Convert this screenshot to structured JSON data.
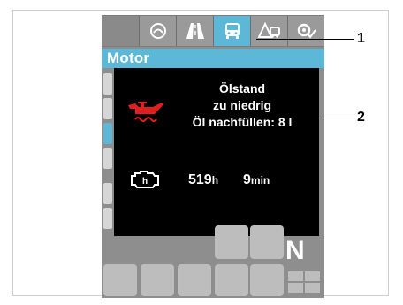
{
  "tabs": [
    {
      "icon": "blank-tab",
      "active": false
    },
    {
      "icon": "speedometer-icon",
      "active": false
    },
    {
      "icon": "road-icon",
      "active": false
    },
    {
      "icon": "bus-icon",
      "active": true
    },
    {
      "icon": "warning-bus-icon",
      "active": false
    },
    {
      "icon": "settings-check-icon",
      "active": false
    }
  ],
  "title": "Motor",
  "message": {
    "line1": "Ölstand",
    "line2": "zu niedrig",
    "line3": "Öl nachfüllen: 8 l"
  },
  "engine_hours": {
    "hours": "519",
    "hours_unit": "h",
    "minutes": "9",
    "minutes_unit": "min"
  },
  "gear": "N",
  "callouts": {
    "c1": "1",
    "c2": "2"
  },
  "colors": {
    "accent": "#5cb8d6",
    "warning": "#e02020",
    "panel": "#000000"
  }
}
